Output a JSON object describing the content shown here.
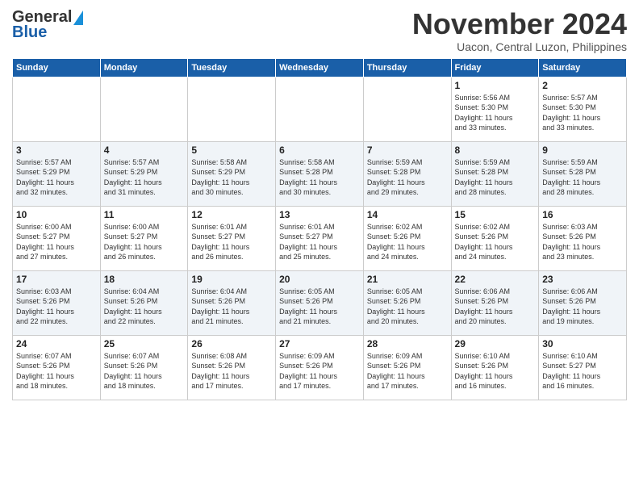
{
  "header": {
    "logo_line1": "General",
    "logo_line2": "Blue",
    "month_title": "November 2024",
    "location": "Uacon, Central Luzon, Philippines"
  },
  "weekdays": [
    "Sunday",
    "Monday",
    "Tuesday",
    "Wednesday",
    "Thursday",
    "Friday",
    "Saturday"
  ],
  "weeks": [
    [
      {
        "day": "",
        "info": ""
      },
      {
        "day": "",
        "info": ""
      },
      {
        "day": "",
        "info": ""
      },
      {
        "day": "",
        "info": ""
      },
      {
        "day": "",
        "info": ""
      },
      {
        "day": "1",
        "info": "Sunrise: 5:56 AM\nSunset: 5:30 PM\nDaylight: 11 hours\nand 33 minutes."
      },
      {
        "day": "2",
        "info": "Sunrise: 5:57 AM\nSunset: 5:30 PM\nDaylight: 11 hours\nand 33 minutes."
      }
    ],
    [
      {
        "day": "3",
        "info": "Sunrise: 5:57 AM\nSunset: 5:29 PM\nDaylight: 11 hours\nand 32 minutes."
      },
      {
        "day": "4",
        "info": "Sunrise: 5:57 AM\nSunset: 5:29 PM\nDaylight: 11 hours\nand 31 minutes."
      },
      {
        "day": "5",
        "info": "Sunrise: 5:58 AM\nSunset: 5:29 PM\nDaylight: 11 hours\nand 30 minutes."
      },
      {
        "day": "6",
        "info": "Sunrise: 5:58 AM\nSunset: 5:28 PM\nDaylight: 11 hours\nand 30 minutes."
      },
      {
        "day": "7",
        "info": "Sunrise: 5:59 AM\nSunset: 5:28 PM\nDaylight: 11 hours\nand 29 minutes."
      },
      {
        "day": "8",
        "info": "Sunrise: 5:59 AM\nSunset: 5:28 PM\nDaylight: 11 hours\nand 28 minutes."
      },
      {
        "day": "9",
        "info": "Sunrise: 5:59 AM\nSunset: 5:28 PM\nDaylight: 11 hours\nand 28 minutes."
      }
    ],
    [
      {
        "day": "10",
        "info": "Sunrise: 6:00 AM\nSunset: 5:27 PM\nDaylight: 11 hours\nand 27 minutes."
      },
      {
        "day": "11",
        "info": "Sunrise: 6:00 AM\nSunset: 5:27 PM\nDaylight: 11 hours\nand 26 minutes."
      },
      {
        "day": "12",
        "info": "Sunrise: 6:01 AM\nSunset: 5:27 PM\nDaylight: 11 hours\nand 26 minutes."
      },
      {
        "day": "13",
        "info": "Sunrise: 6:01 AM\nSunset: 5:27 PM\nDaylight: 11 hours\nand 25 minutes."
      },
      {
        "day": "14",
        "info": "Sunrise: 6:02 AM\nSunset: 5:26 PM\nDaylight: 11 hours\nand 24 minutes."
      },
      {
        "day": "15",
        "info": "Sunrise: 6:02 AM\nSunset: 5:26 PM\nDaylight: 11 hours\nand 24 minutes."
      },
      {
        "day": "16",
        "info": "Sunrise: 6:03 AM\nSunset: 5:26 PM\nDaylight: 11 hours\nand 23 minutes."
      }
    ],
    [
      {
        "day": "17",
        "info": "Sunrise: 6:03 AM\nSunset: 5:26 PM\nDaylight: 11 hours\nand 22 minutes."
      },
      {
        "day": "18",
        "info": "Sunrise: 6:04 AM\nSunset: 5:26 PM\nDaylight: 11 hours\nand 22 minutes."
      },
      {
        "day": "19",
        "info": "Sunrise: 6:04 AM\nSunset: 5:26 PM\nDaylight: 11 hours\nand 21 minutes."
      },
      {
        "day": "20",
        "info": "Sunrise: 6:05 AM\nSunset: 5:26 PM\nDaylight: 11 hours\nand 21 minutes."
      },
      {
        "day": "21",
        "info": "Sunrise: 6:05 AM\nSunset: 5:26 PM\nDaylight: 11 hours\nand 20 minutes."
      },
      {
        "day": "22",
        "info": "Sunrise: 6:06 AM\nSunset: 5:26 PM\nDaylight: 11 hours\nand 20 minutes."
      },
      {
        "day": "23",
        "info": "Sunrise: 6:06 AM\nSunset: 5:26 PM\nDaylight: 11 hours\nand 19 minutes."
      }
    ],
    [
      {
        "day": "24",
        "info": "Sunrise: 6:07 AM\nSunset: 5:26 PM\nDaylight: 11 hours\nand 18 minutes."
      },
      {
        "day": "25",
        "info": "Sunrise: 6:07 AM\nSunset: 5:26 PM\nDaylight: 11 hours\nand 18 minutes."
      },
      {
        "day": "26",
        "info": "Sunrise: 6:08 AM\nSunset: 5:26 PM\nDaylight: 11 hours\nand 17 minutes."
      },
      {
        "day": "27",
        "info": "Sunrise: 6:09 AM\nSunset: 5:26 PM\nDaylight: 11 hours\nand 17 minutes."
      },
      {
        "day": "28",
        "info": "Sunrise: 6:09 AM\nSunset: 5:26 PM\nDaylight: 11 hours\nand 17 minutes."
      },
      {
        "day": "29",
        "info": "Sunrise: 6:10 AM\nSunset: 5:26 PM\nDaylight: 11 hours\nand 16 minutes."
      },
      {
        "day": "30",
        "info": "Sunrise: 6:10 AM\nSunset: 5:27 PM\nDaylight: 11 hours\nand 16 minutes."
      }
    ]
  ]
}
